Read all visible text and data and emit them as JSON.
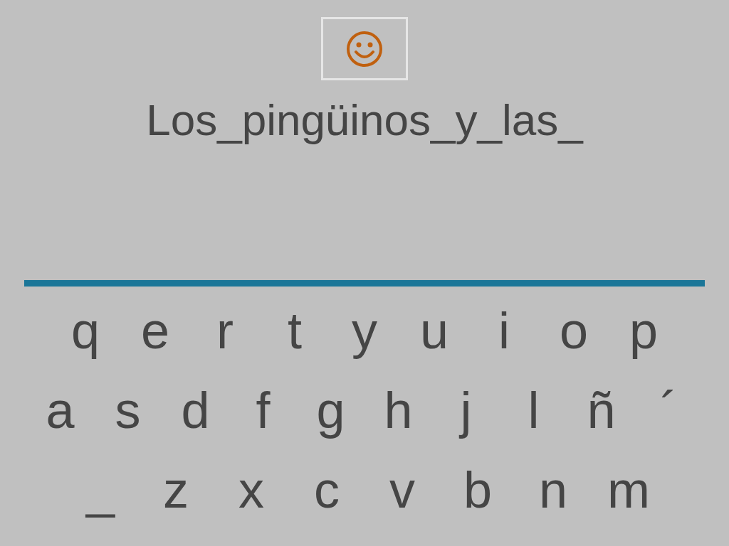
{
  "answer": {
    "text": "Los_pingüinos_y_las_"
  },
  "keyboard": {
    "rows": [
      [
        "q",
        "e",
        "r",
        "t",
        "y",
        "u",
        "i",
        "o",
        "p"
      ],
      [
        "a",
        "s",
        "d",
        "f",
        "g",
        "h",
        "j",
        "l",
        "ñ",
        "´"
      ],
      [
        "_",
        "z",
        "x",
        "c",
        "v",
        "b",
        "n",
        "m"
      ]
    ]
  }
}
